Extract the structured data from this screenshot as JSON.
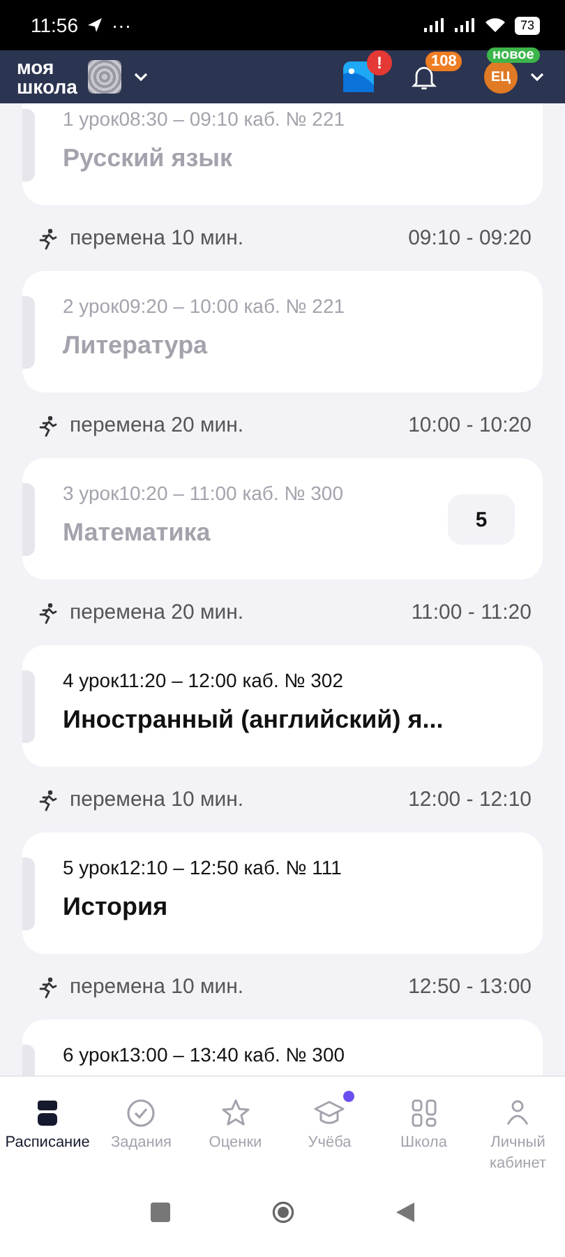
{
  "status_bar": {
    "time": "11:56",
    "dots": "···",
    "battery": "73"
  },
  "header": {
    "logo": "моя\nшкола",
    "notifications_count": "108",
    "avatar_initials": "ЕЦ",
    "new_badge": "новое",
    "alert": "!"
  },
  "schedule": [
    {
      "kind": "lesson",
      "meta": "1 урок08:30 – 09:10 каб. № 221",
      "subject": "Русский язык",
      "past": true
    },
    {
      "kind": "break",
      "label": "перемена 10 мин.",
      "time": "09:10 - 09:20"
    },
    {
      "kind": "lesson",
      "meta": "2 урок09:20 – 10:00 каб. № 221",
      "subject": "Литература",
      "past": true
    },
    {
      "kind": "break",
      "label": "перемена 20 мин.",
      "time": "10:00 - 10:20"
    },
    {
      "kind": "lesson",
      "meta": "3 урок10:20 – 11:00 каб. № 300",
      "subject": "Математика",
      "past": true,
      "grade": "5"
    },
    {
      "kind": "break",
      "label": "перемена 20 мин.",
      "time": "11:00 - 11:20"
    },
    {
      "kind": "lesson",
      "meta": "4 урок11:20 – 12:00 каб. № 302",
      "subject": "Иностранный (английский) я...",
      "past": false
    },
    {
      "kind": "break",
      "label": "перемена 10 мин.",
      "time": "12:00 - 12:10"
    },
    {
      "kind": "lesson",
      "meta": "5 урок12:10 – 12:50 каб. № 111",
      "subject": "История",
      "past": false
    },
    {
      "kind": "break",
      "label": "перемена 10 мин.",
      "time": "12:50 - 13:00"
    },
    {
      "kind": "lesson",
      "meta": "6 урок13:00 – 13:40 каб. № 300",
      "past": false
    }
  ],
  "tabs": [
    {
      "label": "Расписание",
      "selected": true,
      "dot": false
    },
    {
      "label": "Задания",
      "selected": false,
      "dot": false
    },
    {
      "label": "Оценки",
      "selected": false,
      "dot": false
    },
    {
      "label": "Учёба",
      "selected": false,
      "dot": true
    },
    {
      "label": "Школа",
      "selected": false,
      "dot": false
    },
    {
      "label": "Личный кабинет",
      "selected": false,
      "dot": false
    }
  ]
}
